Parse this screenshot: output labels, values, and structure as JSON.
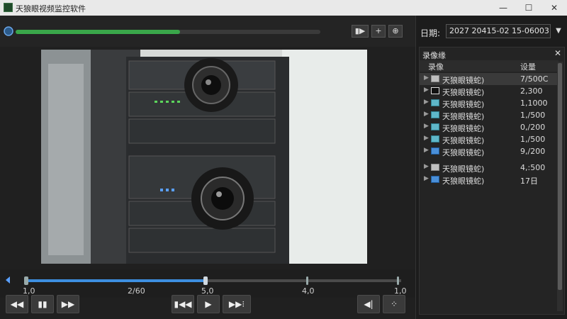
{
  "window": {
    "title": "天狼眼视频监控软件",
    "min": "—",
    "max": "☐",
    "close": "✕"
  },
  "player": {
    "progress_fraction": 0.54,
    "top_buttons": {
      "snapshot": "▮▶",
      "add": "+",
      "record": "⊕"
    },
    "timeline": {
      "position_fraction": 0.48,
      "labels": [
        "1,0",
        "2/60",
        "5,0",
        "4,0",
        "1,0"
      ]
    },
    "controls": {
      "rewind": "◀◀",
      "pause": "▮▮",
      "step_forward": "▶▶",
      "prev": "▮◀◀",
      "play": "▶",
      "fast_forward": "▶▶⁝",
      "volume": "◀|",
      "fullscreen": "⁘"
    }
  },
  "sidebar": {
    "date_label": "日期:",
    "date_value": "2027 20415-02 15-06003",
    "date_dropdown": "▼",
    "panel_title": "录像缘",
    "panel_close": "✕",
    "columns": {
      "name": "录像",
      "size": "设量"
    },
    "rows": [
      {
        "name": "天狼眼镜蛇)",
        "size": "7/500C",
        "icon": "folder-gray",
        "selected": true
      },
      {
        "name": "天狼眼镜蛇)",
        "size": "2,300",
        "icon": "folder-dark"
      },
      {
        "name": "天狼眼镜蛇)",
        "size": "1,1000",
        "icon": "folder-teal"
      },
      {
        "name": "天狼眼镜蛇)",
        "size": "1,/500",
        "icon": "folder-teal"
      },
      {
        "name": "天狼眼镜蛇)",
        "size": "0,/200",
        "icon": "folder-teal"
      },
      {
        "name": "天狼眼镜蛇)",
        "size": "1,/500",
        "icon": "folder-teal"
      },
      {
        "name": "天狼眼镜蛇)",
        "size": "9,/200",
        "icon": "folder-blue"
      },
      {
        "name": "天狼眼镜蛇)",
        "size": "4,:500",
        "icon": "folder-gray"
      },
      {
        "name": "天狼眼镜蛇)",
        "size": "17日",
        "icon": "folder-blue"
      }
    ]
  }
}
